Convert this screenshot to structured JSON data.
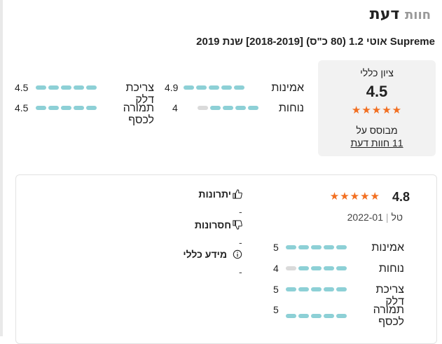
{
  "header": {
    "title_main": "דעת",
    "title_dim": "חוות"
  },
  "subtitle": "Supreme אוטי 1.2 (80 כ\"ס) [2018-2019] שנת 2019",
  "summary": {
    "label": "ציון כללי",
    "score": "4.5",
    "stars": "★★★★★",
    "based_on": "מבוסס על",
    "reviews_link": "11 חוות דעת"
  },
  "metrics": [
    {
      "label": "אמינות",
      "value": "4.9",
      "filled": 5
    },
    {
      "label": "צריכת דלק",
      "value": "4.5",
      "filled": 5
    },
    {
      "label": "נוחות",
      "value": "4",
      "filled": 4
    },
    {
      "label": "תמורה לכסף",
      "value": "4.5",
      "filled": 5
    }
  ],
  "review": {
    "score": "4.8",
    "stars": "★★★★★",
    "author": "טל",
    "date": "2022-01",
    "metrics": [
      {
        "label": "אמינות",
        "value": "5",
        "filled": 5
      },
      {
        "label": "נוחות",
        "value": "4",
        "filled": 4
      },
      {
        "label": "צריכת דלק",
        "value": "5",
        "filled": 5
      },
      {
        "label": "תמורה לכסף",
        "value": "5",
        "filled": 5
      }
    ],
    "pros_title": "יתרונות",
    "pros_text": "-",
    "cons_title": "חסרונות",
    "cons_text": "-",
    "general_title": "מידע כללי",
    "general_text": "-"
  },
  "colors": {
    "bar_on": "#8dd0d6",
    "bar_off": "#dadada",
    "star": "#f26f21"
  }
}
